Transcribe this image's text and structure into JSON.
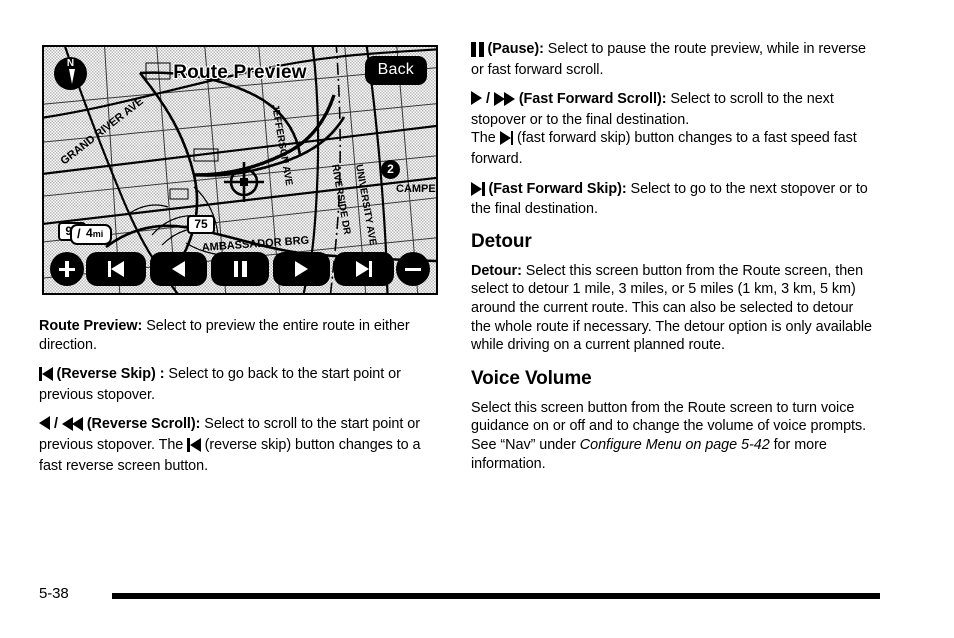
{
  "page": {
    "folio": "5-38"
  },
  "nav_screen": {
    "title": "Route Preview",
    "back_label": "Back",
    "compass_label": "N",
    "scale": {
      "value": "4",
      "unit": "mi",
      "prefix": "/"
    },
    "waypoint_label": "2",
    "shields": [
      {
        "name": "shield-75",
        "label": "75"
      },
      {
        "name": "shield-96",
        "label": "96"
      }
    ],
    "street_labels": [
      "GRAND RIVER AVE",
      "JEFFERSON AVE",
      "RIVERSIDE DR",
      "UNIVERSITY AVE",
      "CAMPE",
      "AMBASSADOR BRG"
    ],
    "controls": [
      {
        "name": "zoom-in-button",
        "icon": "plus-icon"
      },
      {
        "name": "reverse-skip-button",
        "icon": "skip-back-icon"
      },
      {
        "name": "reverse-scroll-button",
        "icon": "play-back-icon"
      },
      {
        "name": "pause-button",
        "icon": "pause-icon"
      },
      {
        "name": "fast-forward-scroll-button",
        "icon": "play-icon"
      },
      {
        "name": "fast-forward-skip-button",
        "icon": "skip-forward-icon"
      },
      {
        "name": "zoom-out-button",
        "icon": "minus-icon"
      }
    ]
  },
  "left_column": {
    "route_preview": {
      "term": "Route Preview",
      "colon": ":",
      "text": " Select to preview the entire route in either direction."
    },
    "reverse_skip": {
      "term": "(Reverse Skip)",
      "colon": " :",
      "text": " Select to go back to the start point or previous stopover."
    },
    "reverse_scroll": {
      "slash": "/",
      "term": "(Reverse Scroll):",
      "text_before": " Select to scroll to the start point or previous stopover. The ",
      "text_after": " (reverse skip) button changes to a fast reverse screen button."
    }
  },
  "right_column": {
    "pause": {
      "term": "(Pause):",
      "text": " Select to pause the route preview, while in reverse or fast forward scroll."
    },
    "fast_forward_scroll": {
      "slash": "/",
      "term": "(Fast Forward Scroll):",
      "text_after_term": " Select to scroll to the next stopover or to the final destination.",
      "line_the": "The ",
      "text_after_icon": " (fast forward skip) button changes to a fast speed fast forward."
    },
    "fast_forward_skip": {
      "term": "(Fast Forward Skip):",
      "text": " Select to go to the next stopover or to the final destination."
    },
    "detour": {
      "heading": "Detour",
      "term": "Detour",
      "colon": ":",
      "text": " Select this screen button from the Route screen, then select to detour 1 mile, 3 miles, or 5 miles (1 km, 3 km, 5 km) around the current route. This can also be selected to detour the whole route if necessary. The detour option is only available while driving on a current planned route."
    },
    "voice_volume": {
      "heading": "Voice Volume",
      "text_before": "Select this screen button from the Route screen to turn voice guidance on or off and to change the volume of voice prompts. See “Nav” under ",
      "italic_ref": "Configure Menu on page 5-42",
      "text_after": " for more information."
    }
  }
}
